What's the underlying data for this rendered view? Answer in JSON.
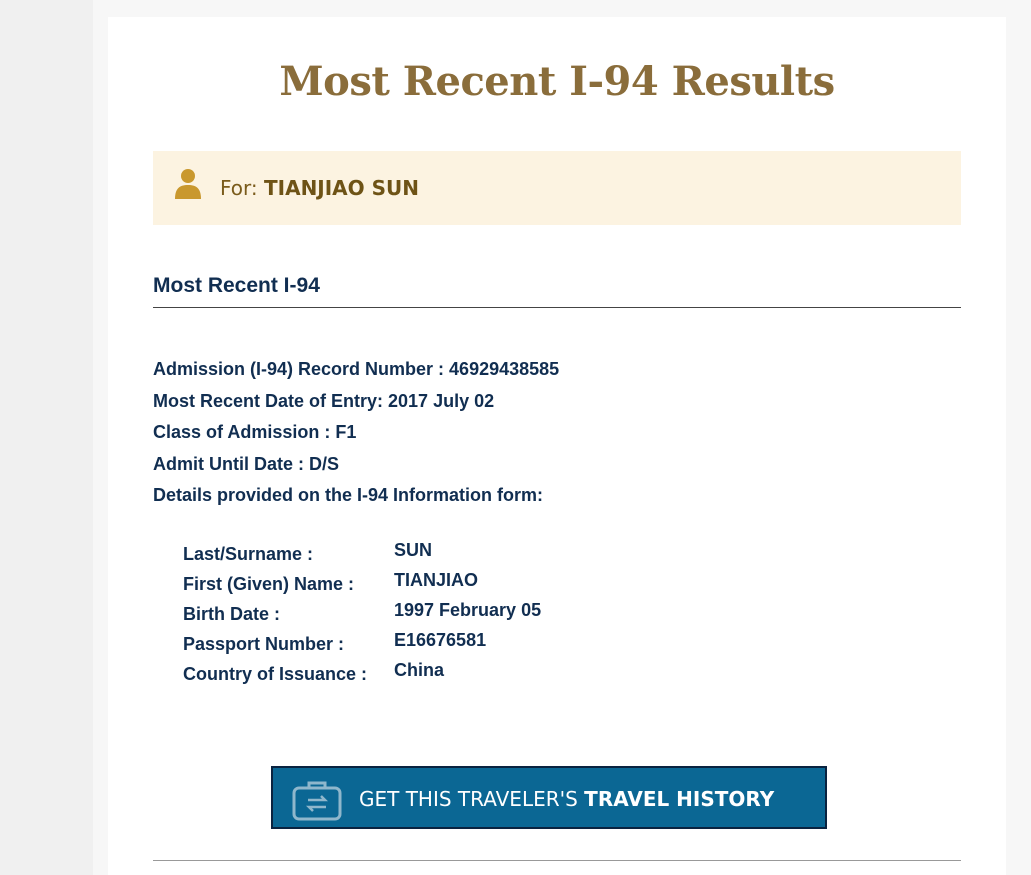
{
  "page": {
    "title": "Most Recent I-94 Results"
  },
  "traveler": {
    "for_label": "For:",
    "name": "TIANJIAO SUN"
  },
  "section": {
    "heading": "Most Recent I-94"
  },
  "record": {
    "lines": [
      "Admission (I-94) Record Number : 46929438585",
      "Most Recent Date of Entry: 2017 July 02",
      "Class of Admission : F1",
      "Admit Until Date : D/S",
      "Details provided on the I-94 Information form:"
    ]
  },
  "details": [
    {
      "label": "Last/Surname :",
      "value": "SUN"
    },
    {
      "label": "First (Given) Name :",
      "value": "TIANJIAO"
    },
    {
      "label": "Birth Date :",
      "value": "1997 February 05"
    },
    {
      "label": "Passport Number :",
      "value": "E16676581"
    },
    {
      "label": "Country of Issuance :",
      "value": "China"
    }
  ],
  "history_button": {
    "prefix": "GET THIS TRAVELER'S ",
    "strong": "TRAVEL HISTORY",
    "icon": "briefcase-icon"
  },
  "colors": {
    "title": "#8a6d3b",
    "text_navy": "#112e51",
    "for_box_bg": "#fcf3e1",
    "button_bg": "#0b6794",
    "button_border": "#0a2340"
  }
}
